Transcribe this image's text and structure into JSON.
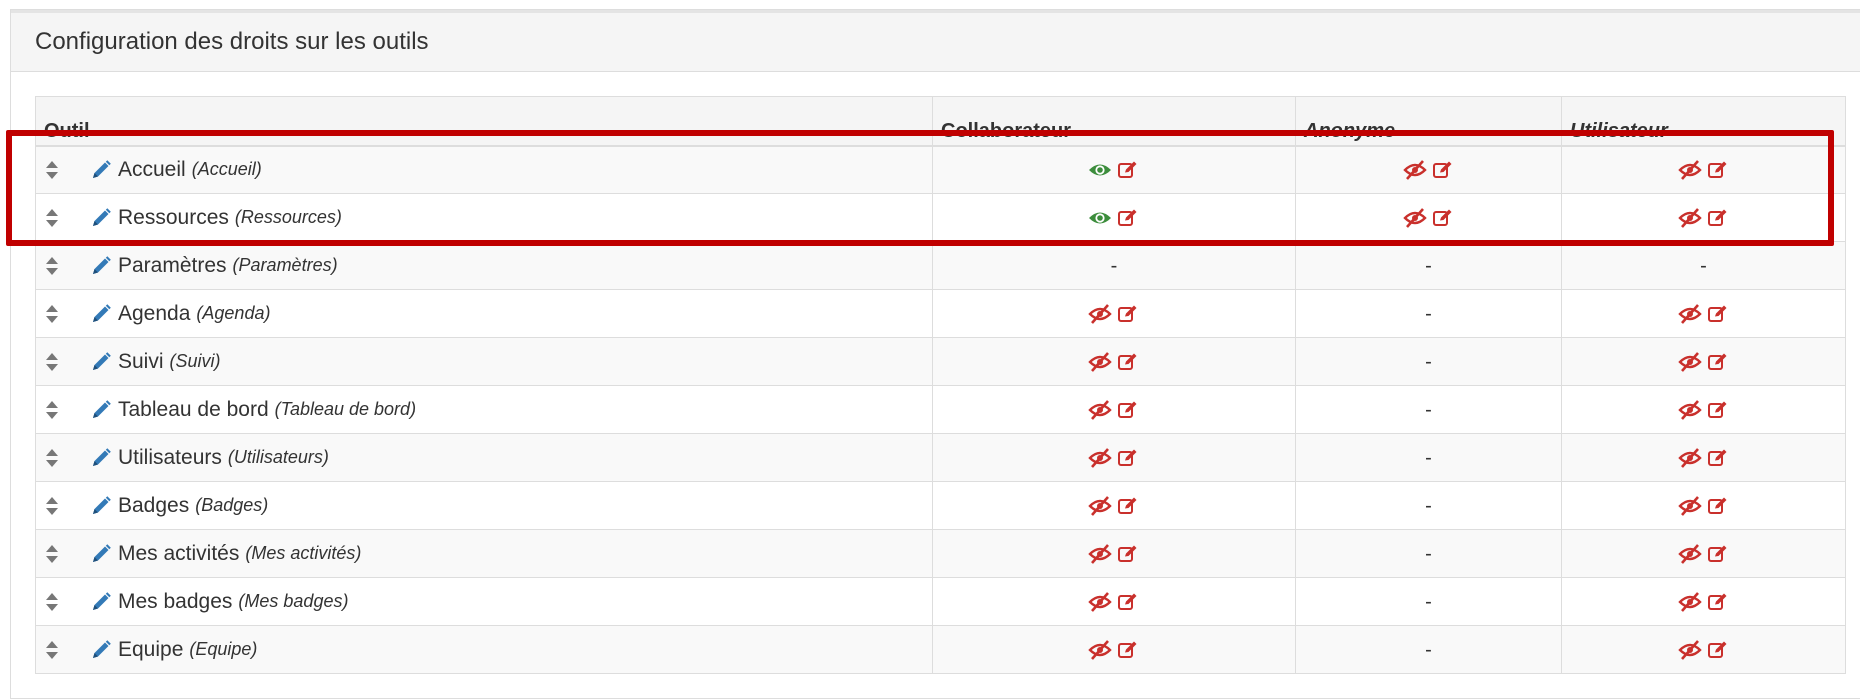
{
  "panel": {
    "title": "Configuration des droits sur les outils"
  },
  "table": {
    "headers": [
      {
        "label": "Outil",
        "italic": false
      },
      {
        "label": "Collaborateur",
        "italic": false
      },
      {
        "label": "Anonyme",
        "italic": true
      },
      {
        "label": "Utilisateur",
        "italic": true
      }
    ],
    "rows": [
      {
        "name": "Accueil",
        "key": "(Accueil)",
        "collaborateur": "view",
        "anonyme": "hidden",
        "utilisateur": "hidden"
      },
      {
        "name": "Ressources",
        "key": "(Ressources)",
        "collaborateur": "view",
        "anonyme": "hidden",
        "utilisateur": "hidden"
      },
      {
        "name": "Paramètres",
        "key": "(Paramètres)",
        "collaborateur": "-",
        "anonyme": "-",
        "utilisateur": "-"
      },
      {
        "name": "Agenda",
        "key": "(Agenda)",
        "collaborateur": "hidden",
        "anonyme": "-",
        "utilisateur": "hidden"
      },
      {
        "name": "Suivi",
        "key": "(Suivi)",
        "collaborateur": "hidden",
        "anonyme": "-",
        "utilisateur": "hidden"
      },
      {
        "name": "Tableau de bord",
        "key": "(Tableau de bord)",
        "collaborateur": "hidden",
        "anonyme": "-",
        "utilisateur": "hidden"
      },
      {
        "name": "Utilisateurs",
        "key": "(Utilisateurs)",
        "collaborateur": "hidden",
        "anonyme": "-",
        "utilisateur": "hidden"
      },
      {
        "name": "Badges",
        "key": "(Badges)",
        "collaborateur": "hidden",
        "anonyme": "-",
        "utilisateur": "hidden"
      },
      {
        "name": "Mes activités",
        "key": "(Mes activités)",
        "collaborateur": "hidden",
        "anonyme": "-",
        "utilisateur": "hidden"
      },
      {
        "name": "Mes badges",
        "key": "(Mes badges)",
        "collaborateur": "hidden",
        "anonyme": "-",
        "utilisateur": "hidden"
      },
      {
        "name": "Equipe",
        "key": "(Equipe)",
        "collaborateur": "hidden",
        "anonyme": "-",
        "utilisateur": "hidden"
      }
    ]
  },
  "icons": {
    "sort": "sort-icon",
    "edit_tool": "pencil-icon",
    "view": "eye-icon",
    "hidden": "eye-slash-icon",
    "edit_rights": "edit-square-icon"
  },
  "colors": {
    "view": "#3c8d3c",
    "hidden": "#c9302c",
    "edit": "#c9302c",
    "pencil": "#337ab7",
    "highlight": "#c00000"
  }
}
